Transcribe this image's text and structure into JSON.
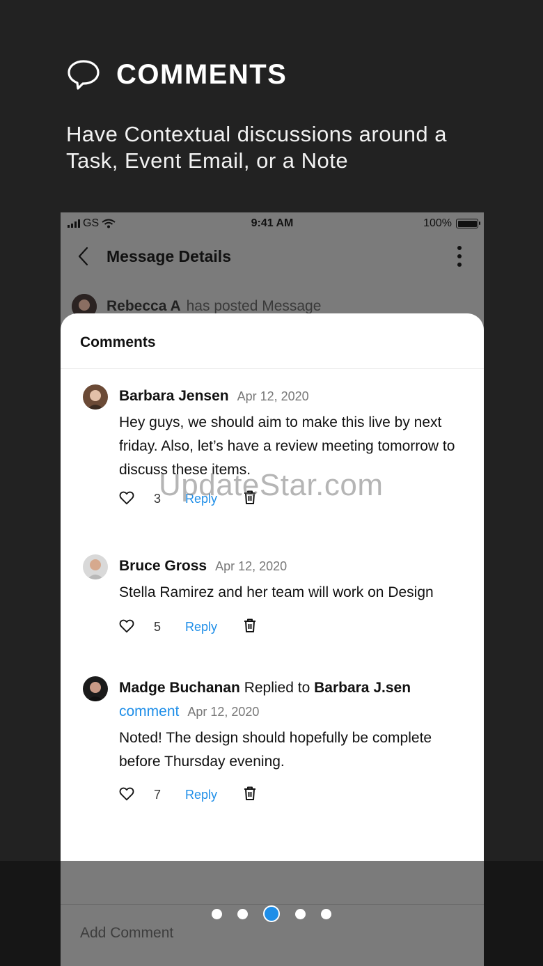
{
  "hero": {
    "title": "COMMENTS",
    "subtitle": "Have Contextual discussions around a Task, Event Email, or a Note"
  },
  "statusbar": {
    "carrier": "GS",
    "time": "9:41 AM",
    "battery": "100%"
  },
  "navbar": {
    "title": "Message Details"
  },
  "posted": {
    "author": "Rebecca A",
    "action": "has posted Message"
  },
  "sheet": {
    "title": "Comments"
  },
  "comments": [
    {
      "author": "Barbara Jensen",
      "date": "Apr 12, 2020",
      "text": "Hey guys, we should aim to make this live by next friday. Also, let’s have a review meeting tomorrow to discuss these items.",
      "likes": "3",
      "reply_label": "Reply"
    },
    {
      "author": "Bruce Gross",
      "date": "Apr 12, 2020",
      "text": "Stella Ramirez and her team will work on Design",
      "likes": "5",
      "reply_label": "Reply"
    },
    {
      "author": "Madge Buchanan",
      "replied_to_label": "Replied to",
      "replied_to": "Barbara J.sen",
      "link": "comment",
      "date": "Apr 12, 2020",
      "text": "Noted! The design should hopefully be complete before Thursday evening.",
      "likes": "7",
      "reply_label": "Reply"
    }
  ],
  "watermark": "UpdateStar.com",
  "add_comment": {
    "placeholder": "Add Comment"
  },
  "pager": {
    "total": 5,
    "active_index": 2
  },
  "colors": {
    "accent": "#1e8ee8",
    "background": "#222222",
    "phone_dim": "#7b7b7b"
  },
  "icons": [
    "chat-bubble-icon",
    "chevron-left-icon",
    "more-vertical-icon",
    "heart-icon",
    "trash-icon",
    "wifi-icon",
    "signal-icon",
    "battery-icon"
  ]
}
